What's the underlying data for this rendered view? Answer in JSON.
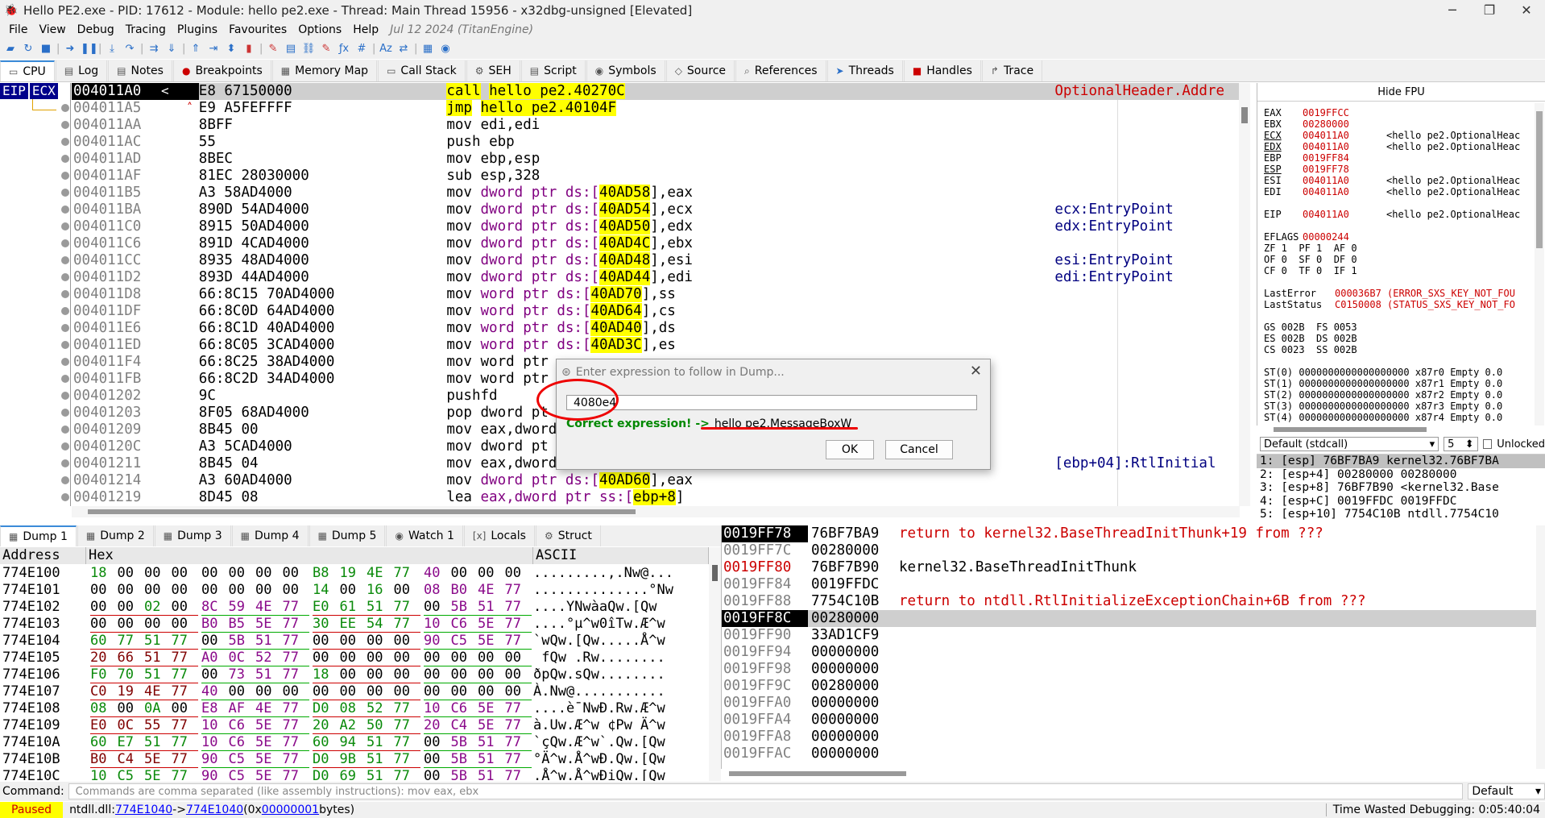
{
  "window": {
    "title": "Hello PE2.exe - PID: 17612 - Module: hello pe2.exe - Thread: Main Thread 15956 - x32dbg-unsigned [Elevated]",
    "minimize": "─",
    "maximize": "❐",
    "close": "✕"
  },
  "menu": {
    "items": [
      "File",
      "View",
      "Debug",
      "Tracing",
      "Plugins",
      "Favourites",
      "Options",
      "Help"
    ],
    "date": "Jul 12 2024 (TitanEngine)"
  },
  "tabs": [
    {
      "label": "CPU",
      "icon": "▭"
    },
    {
      "label": "Log",
      "icon": "▤"
    },
    {
      "label": "Notes",
      "icon": "▤"
    },
    {
      "label": "Breakpoints",
      "icon": "●"
    },
    {
      "label": "Memory Map",
      "icon": "▦"
    },
    {
      "label": "Call Stack",
      "icon": "▭"
    },
    {
      "label": "SEH",
      "icon": "⚙"
    },
    {
      "label": "Script",
      "icon": "▤"
    },
    {
      "label": "Symbols",
      "icon": "◉"
    },
    {
      "label": "Source",
      "icon": "◇"
    },
    {
      "label": "References",
      "icon": "⌕"
    },
    {
      "label": "Threads",
      "icon": "➤"
    },
    {
      "label": "Handles",
      "icon": "■"
    },
    {
      "label": "Trace",
      "icon": "↱"
    }
  ],
  "disasm": {
    "eip_label": "EIP",
    "ecx_label": "ECX",
    "cur_arrow": "<",
    "rows": [
      {
        "addr": "004011A0",
        "bytes": "E8 67150000",
        "m": "call",
        "ops": "hello pe2.40270C",
        "cmt": "OptionalHeader.Addre"
      },
      {
        "addr": "004011A5",
        "bytes": "E9 A5FEFFFF",
        "m": "jmp",
        "ops": "hello pe2.40104F",
        "cmt": ""
      },
      {
        "addr": "004011AA",
        "bytes": "8BFF",
        "m": "mov",
        "ops": "edi,edi",
        "cmt": ""
      },
      {
        "addr": "004011AC",
        "bytes": "55",
        "m": "push",
        "ops": "ebp",
        "cmt": ""
      },
      {
        "addr": "004011AD",
        "bytes": "8BEC",
        "m": "mov",
        "ops": "ebp,esp",
        "cmt": ""
      },
      {
        "addr": "004011AF",
        "bytes": "81EC 28030000",
        "m": "sub",
        "ops": "esp,328",
        "cmt": ""
      },
      {
        "addr": "004011B5",
        "bytes": "A3 58AD4000",
        "m": "mov",
        "pre": "dword ptr ds:[",
        "mem": "40AD58",
        "post": "],eax",
        "cmt": ""
      },
      {
        "addr": "004011BA",
        "bytes": "890D 54AD4000",
        "m": "mov",
        "pre": "dword ptr ds:[",
        "mem": "40AD54",
        "post": "],ecx",
        "cmt": "ecx:EntryPoint"
      },
      {
        "addr": "004011C0",
        "bytes": "8915 50AD4000",
        "m": "mov",
        "pre": "dword ptr ds:[",
        "mem": "40AD50",
        "post": "],edx",
        "cmt": "edx:EntryPoint"
      },
      {
        "addr": "004011C6",
        "bytes": "891D 4CAD4000",
        "m": "mov",
        "pre": "dword ptr ds:[",
        "mem": "40AD4C",
        "post": "],ebx",
        "cmt": ""
      },
      {
        "addr": "004011CC",
        "bytes": "8935 48AD4000",
        "m": "mov",
        "pre": "dword ptr ds:[",
        "mem": "40AD48",
        "post": "],esi",
        "cmt": "esi:EntryPoint"
      },
      {
        "addr": "004011D2",
        "bytes": "893D 44AD4000",
        "m": "mov",
        "pre": "dword ptr ds:[",
        "mem": "40AD44",
        "post": "],edi",
        "cmt": "edi:EntryPoint"
      },
      {
        "addr": "004011D8",
        "bytes": "66:8C15 70AD4000",
        "m": "mov",
        "pre": "word ptr ds:[",
        "mem": "40AD70",
        "post": "],ss",
        "cmt": ""
      },
      {
        "addr": "004011DF",
        "bytes": "66:8C0D 64AD4000",
        "m": "mov",
        "pre": "word ptr ds:[",
        "mem": "40AD64",
        "post": "],cs",
        "cmt": ""
      },
      {
        "addr": "004011E6",
        "bytes": "66:8C1D 40AD4000",
        "m": "mov",
        "pre": "word ptr ds:[",
        "mem": "40AD40",
        "post": "],ds",
        "cmt": ""
      },
      {
        "addr": "004011ED",
        "bytes": "66:8C05 3CAD4000",
        "m": "mov",
        "pre": "word ptr ds:[",
        "mem": "40AD3C",
        "post": "],es",
        "cmt": ""
      },
      {
        "addr": "004011F4",
        "bytes": "66:8C25 38AD4000",
        "m": "mov",
        "ops": "word ptr",
        "cmt": ""
      },
      {
        "addr": "004011FB",
        "bytes": "66:8C2D 34AD4000",
        "m": "mov",
        "ops": "word ptr",
        "cmt": ""
      },
      {
        "addr": "00401202",
        "bytes": "9C",
        "m": "pushfd",
        "ops": "",
        "cmt": ""
      },
      {
        "addr": "00401203",
        "bytes": "8F05 68AD4000",
        "m": "pop",
        "ops": "dword pt",
        "cmt": ""
      },
      {
        "addr": "00401209",
        "bytes": "8B45 00",
        "m": "mov",
        "ops": "eax,dword",
        "cmt": ""
      },
      {
        "addr": "0040120C",
        "bytes": "A3 5CAD4000",
        "m": "mov",
        "ops": "dword pt",
        "cmt": ""
      },
      {
        "addr": "00401211",
        "bytes": "8B45 04",
        "m": "mov",
        "ops": "eax,dword",
        "cmt": "[ebp+04]:RtlInitial"
      },
      {
        "addr": "00401214",
        "bytes": "A3 60AD4000",
        "m": "mov",
        "pre": "dword ptr ds:[",
        "mem": "40AD60",
        "post": "],eax",
        "cmt": ""
      },
      {
        "addr": "00401219",
        "bytes": "8D45 08",
        "m": "lea",
        "pre": "eax,dword ptr ss:[",
        "mem": "ebp+8",
        "post": "]",
        "cmt": ""
      }
    ]
  },
  "registers": {
    "hide_fpu": "Hide FPU",
    "gp": [
      {
        "n": "EAX",
        "v": "0019FFCC",
        "c": "",
        "u": false
      },
      {
        "n": "EBX",
        "v": "00280000",
        "c": "",
        "u": false
      },
      {
        "n": "ECX",
        "v": "004011A0",
        "c": "<hello pe2.OptionalHeac",
        "u": true
      },
      {
        "n": "EDX",
        "v": "004011A0",
        "c": "<hello pe2.OptionalHeac",
        "u": true
      },
      {
        "n": "EBP",
        "v": "0019FF84",
        "c": "",
        "u": false
      },
      {
        "n": "ESP",
        "v": "0019FF78",
        "c": "",
        "u": true
      },
      {
        "n": "ESI",
        "v": "004011A0",
        "c": "<hello pe2.OptionalHeac",
        "u": false
      },
      {
        "n": "EDI",
        "v": "004011A0",
        "c": "<hello pe2.OptionalHeac",
        "u": false
      }
    ],
    "eip": {
      "n": "EIP",
      "v": "004011A0",
      "c": "<hello pe2.OptionalHeac"
    },
    "eflags": {
      "n": "EFLAGS",
      "v": "00000244"
    },
    "flags": [
      "ZF 1  PF 1  AF 0",
      "OF 0  SF 0  DF 0",
      "CF 0  TF 0  IF 1"
    ],
    "lasterror": {
      "n": "LastError",
      "v": "000036B7 (ERROR_SXS_KEY_NOT_FOU"
    },
    "laststatus": {
      "n": "LastStatus",
      "v": "C0150008 (STATUS_SXS_KEY_NOT_FO"
    },
    "segs": [
      "GS 002B  FS 0053",
      "ES 002B  DS 002B",
      "CS 0023  SS 002B"
    ],
    "fpu": [
      "ST(0) 0000000000000000000 x87r0 Empty 0.0",
      "ST(1) 0000000000000000000 x87r1 Empty 0.0",
      "ST(2) 0000000000000000000 x87r2 Empty 0.0",
      "ST(3) 0000000000000000000 x87r3 Empty 0.0",
      "ST(4) 0000000000000000000 x87r4 Empty 0.0"
    ]
  },
  "callconv": {
    "value": "Default (stdcall)",
    "count": "5",
    "unlocked": "Unlocked"
  },
  "argstack": [
    "1: [esp] 76BF7BA9 kernel32.76BF7BA",
    "2: [esp+4] 00280000 00280000",
    "3: [esp+8] 76BF7B90 <kernel32.Base",
    "4: [esp+C] 0019FFDC 0019FFDC",
    "5: [esp+10] 7754C10B ntdll.7754C10"
  ],
  "dumptabs": [
    {
      "label": "Dump 1",
      "icon": "▦"
    },
    {
      "label": "Dump 2",
      "icon": "▦"
    },
    {
      "label": "Dump 3",
      "icon": "▦"
    },
    {
      "label": "Dump 4",
      "icon": "▦"
    },
    {
      "label": "Dump 5",
      "icon": "▦"
    },
    {
      "label": "Watch 1",
      "icon": "◉"
    },
    {
      "label": "Locals",
      "icon": "[x]"
    },
    {
      "label": "Struct",
      "icon": "⚙"
    }
  ],
  "dump": {
    "headers": {
      "address": "Address",
      "hex": "Hex",
      "ascii": "ASCII"
    },
    "rows": [
      {
        "a": "774E100",
        "h": [
          "18 00 00 00",
          "00 00 00 00",
          "B8 19 4E 77",
          "40 00 00 00"
        ],
        "s": ".........,.Nw@..."
      },
      {
        "a": "774E101",
        "h": [
          "00 00 00 00",
          "00 00 00 00",
          "14 00 16 00",
          "08 B0 4E 77"
        ],
        "s": "..............°Nw"
      },
      {
        "a": "774E102",
        "h": [
          "00 00 02 00",
          "8C 59 4E 77",
          "E0 61 51 77",
          "00 5B 51 77"
        ],
        "s": "....YNwàaQw.[Qw"
      },
      {
        "a": "774E103",
        "h": [
          "00 00 00 00",
          "B0 B5 5E 77",
          "30 EE 54 77",
          "10 C6 5E 77"
        ],
        "s": "....°µ^w0îTw.Æ^w"
      },
      {
        "a": "774E104",
        "h": [
          "60 77 51 77",
          "00 5B 51 77",
          "00 00 00 00",
          "90 C5 5E 77"
        ],
        "s": "`wQw.[Qw.....Å^w"
      },
      {
        "a": "774E105",
        "h": [
          "20 66 51 77",
          "A0 0C 52 77",
          "00 00 00 00",
          "00 00 00 00"
        ],
        "s": " fQw .Rw........"
      },
      {
        "a": "774E106",
        "h": [
          "F0 70 51 77",
          "00 73 51 77",
          "18 00 00 00",
          "00 00 00 00"
        ],
        "s": "ðpQw.sQw........"
      },
      {
        "a": "774E107",
        "h": [
          "C0 19 4E 77",
          "40 00 00 00",
          "00 00 00 00",
          "00 00 00 00"
        ],
        "s": "À.Nw@..........."
      },
      {
        "a": "774E108",
        "h": [
          "08 00 0A 00",
          "E8 AF 4E 77",
          "D0 08 52 77",
          "10 C6 5E 77"
        ],
        "s": "....è¯NwÐ.Rw.Æ^w"
      },
      {
        "a": "774E109",
        "h": [
          "E0 0C 55 77",
          "10 C6 5E 77",
          "20 A2 50 77",
          "20 C4 5E 77"
        ],
        "s": "à.Uw.Æ^w ¢Pw Ä^w"
      },
      {
        "a": "774E10A",
        "h": [
          "60 E7 51 77",
          "10 C6 5E 77",
          "60 94 51 77",
          "00 5B 51 77"
        ],
        "s": "`çQw.Æ^w`.Qw.[Qw"
      },
      {
        "a": "774E10B",
        "h": [
          "B0 C4 5E 77",
          "90 C5 5E 77",
          "D0 9B 51 77",
          "00 5B 51 77"
        ],
        "s": "°Ä^w.Å^wÐ.Qw.[Qw"
      },
      {
        "a": "774E10C",
        "h": [
          "10 C5 5E 77",
          "90 C5 5E 77",
          "D0 69 51 77",
          "00 5B 51 77"
        ],
        "s": ".Å^w.Å^wÐiQw.[Qw"
      }
    ]
  },
  "stack": {
    "rows": [
      {
        "a": "0019FF78",
        "v": "76BF7BA9",
        "c": "return to kernel32.BaseThreadInitThunk+19 from ???"
      },
      {
        "a": "0019FF7C",
        "v": "00280000",
        "c": ""
      },
      {
        "a": "0019FF80",
        "v": "76BF7B90",
        "c": "kernel32.BaseThreadInitThunk"
      },
      {
        "a": "0019FF84",
        "v": "0019FFDC",
        "c": ""
      },
      {
        "a": "0019FF88",
        "v": "7754C10B",
        "c": "return to ntdll.RtlInitializeExceptionChain+6B from ???"
      },
      {
        "a": "0019FF8C",
        "v": "00280000",
        "c": ""
      },
      {
        "a": "0019FF90",
        "v": "33AD1CF9",
        "c": ""
      },
      {
        "a": "0019FF94",
        "v": "00000000",
        "c": ""
      },
      {
        "a": "0019FF98",
        "v": "00000000",
        "c": ""
      },
      {
        "a": "0019FF9C",
        "v": "00280000",
        "c": ""
      },
      {
        "a": "0019FFA0",
        "v": "00000000",
        "c": ""
      },
      {
        "a": "0019FFA4",
        "v": "00000000",
        "c": ""
      },
      {
        "a": "0019FFA8",
        "v": "00000000",
        "c": ""
      },
      {
        "a": "0019FFAC",
        "v": "00000000",
        "c": ""
      }
    ]
  },
  "command": {
    "label": "Command:",
    "placeholder": "Commands are comma separated (like assembly instructions): mov eax, ebx",
    "mode": "Default"
  },
  "status": {
    "state": "Paused",
    "prefix": "ntdll.dll: ",
    "addr1": "774E1040",
    "arrow": " -> ",
    "addr2": "774E1040",
    "mid": " (0x",
    "size": "00000001",
    "suffix": " bytes)",
    "wasted": "Time Wasted Debugging: 0:05:40:04"
  },
  "dialog": {
    "title": "Enter expression to follow in Dump...",
    "input": "4080e4",
    "status_ok": "Correct expression! ->",
    "status_target": "hello pe2.MessageBoxW",
    "ok": "OK",
    "cancel": "Cancel",
    "close": "✕"
  }
}
